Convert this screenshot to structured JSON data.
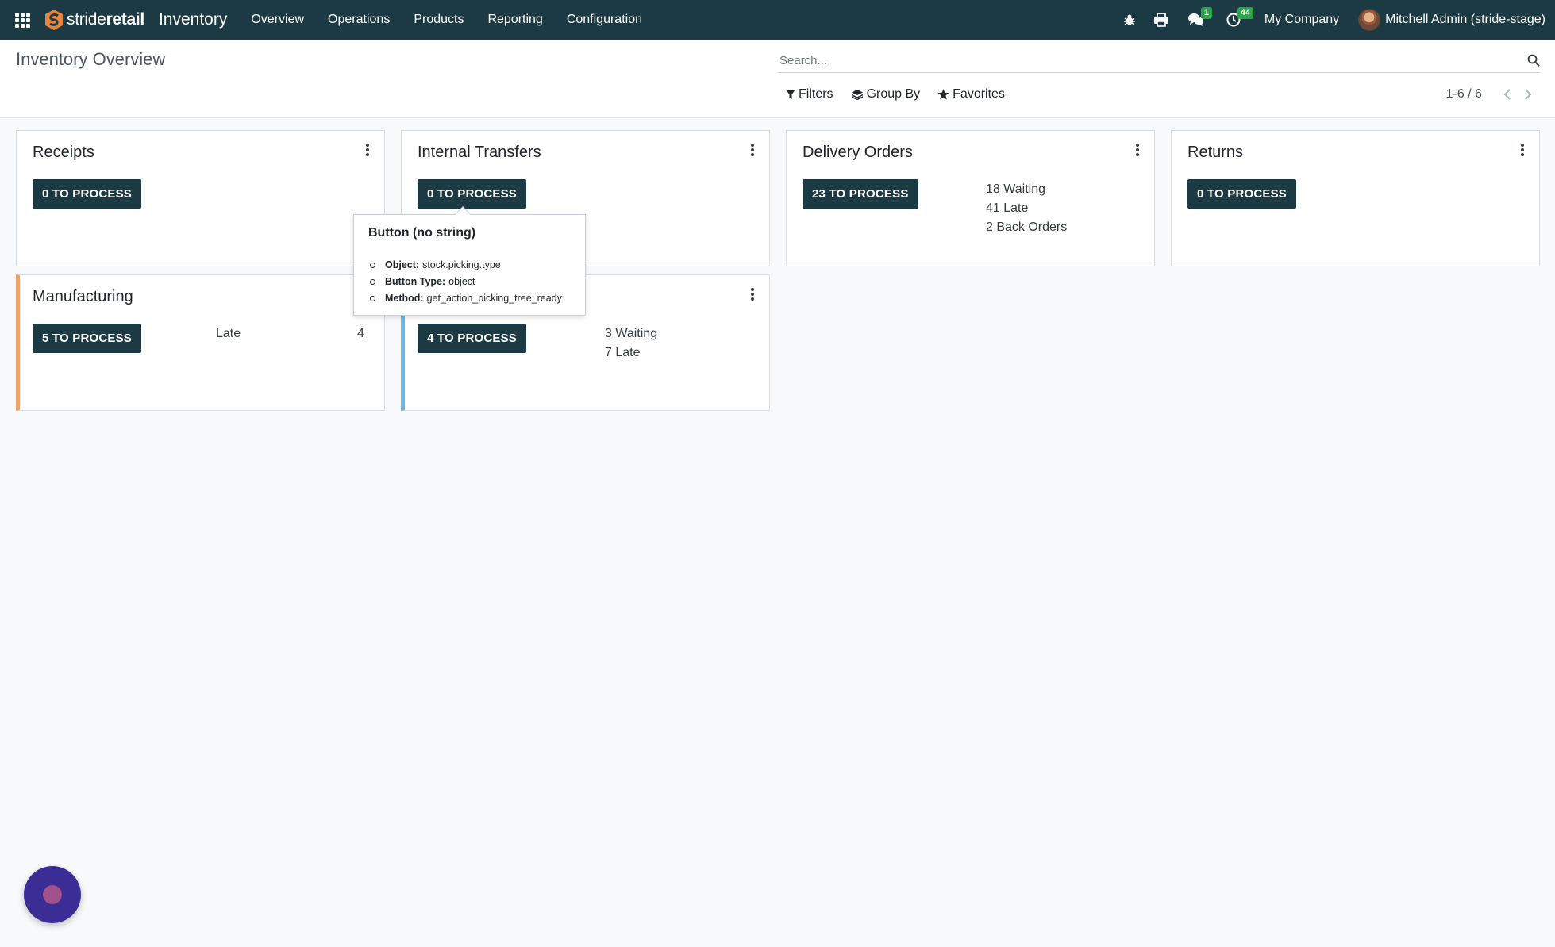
{
  "navbar": {
    "brand_prefix": "stride",
    "brand_suffix": "retail",
    "app_name": "Inventory",
    "menu": [
      "Overview",
      "Operations",
      "Products",
      "Reporting",
      "Configuration"
    ],
    "messages_count": "1",
    "activities_count": "44",
    "company": "My Company",
    "user": "Mitchell Admin (stride-stage)"
  },
  "control_panel": {
    "title": "Inventory Overview",
    "search_placeholder": "Search...",
    "filters_label": "Filters",
    "group_by_label": "Group By",
    "favorites_label": "Favorites",
    "pager": "1-6 / 6"
  },
  "cards": {
    "receipts": {
      "title": "Receipts",
      "button": "0 TO PROCESS"
    },
    "internal": {
      "title": "Internal Transfers",
      "button": "0 TO PROCESS"
    },
    "delivery": {
      "title": "Delivery Orders",
      "button": "23 TO PROCESS",
      "stats": [
        "18 Waiting",
        "41 Late",
        "2 Back Orders"
      ]
    },
    "returns": {
      "title": "Returns",
      "button": "0 TO PROCESS"
    },
    "manufacturing": {
      "title": "Manufacturing",
      "button": "5 TO PROCESS",
      "late_label": "Late",
      "late_count": "4"
    },
    "sixth": {
      "button": "4 TO PROCESS",
      "stats": [
        "3 Waiting",
        "7 Late"
      ]
    }
  },
  "tooltip": {
    "title": "Button (no string)",
    "object_label": "Object:",
    "object_value": "stock.picking.type",
    "type_label": "Button Type:",
    "type_value": "object",
    "method_label": "Method:",
    "method_value": "get_action_picking_tree_ready"
  },
  "colors": {
    "navbar": "#1c3a44",
    "button": "#1c3a44",
    "manufacturing_accent": "#f0a46d",
    "sixth_accent": "#6bb6e0",
    "badge": "#28a745"
  }
}
